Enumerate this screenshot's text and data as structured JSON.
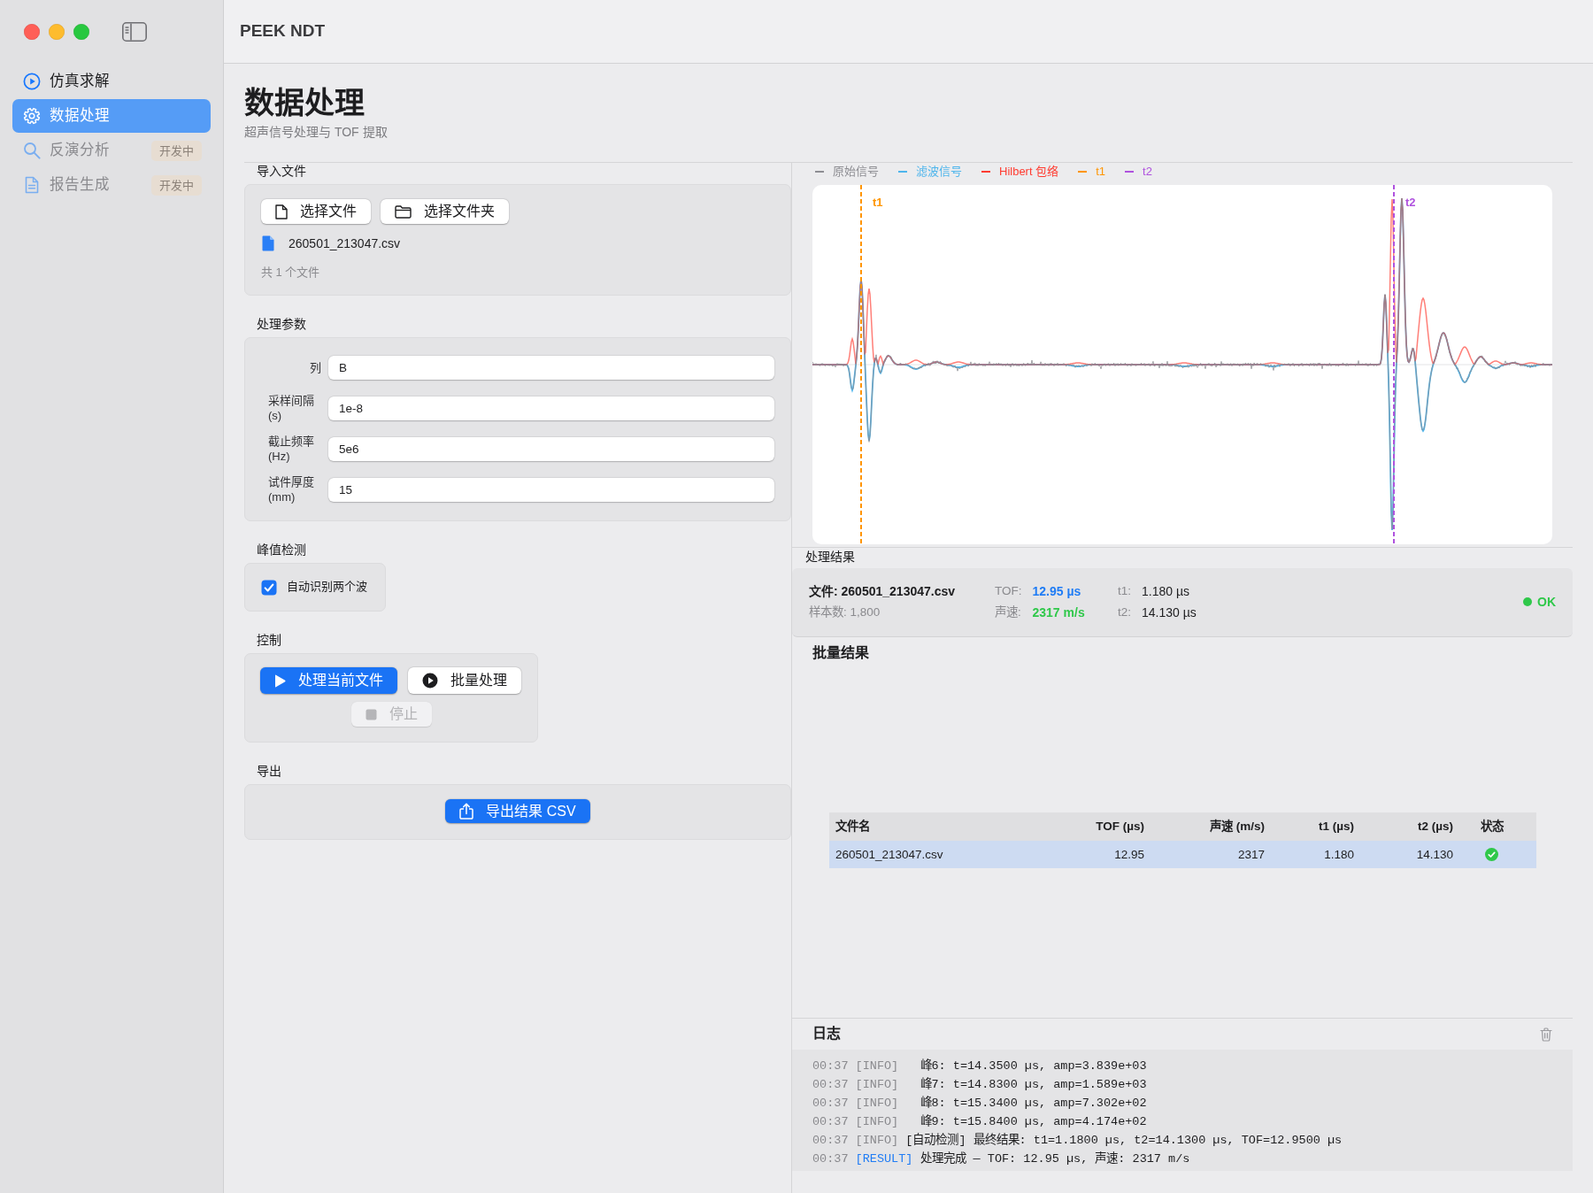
{
  "window": {
    "title": "PEEK NDT"
  },
  "sidebar": {
    "items": [
      {
        "label": "仿真求解",
        "selected": false,
        "disabled": false
      },
      {
        "label": "数据处理",
        "selected": true,
        "disabled": false
      },
      {
        "label": "反演分析",
        "selected": false,
        "disabled": true,
        "badge": "开发中"
      },
      {
        "label": "报告生成",
        "selected": false,
        "disabled": true,
        "badge": "开发中"
      }
    ]
  },
  "page": {
    "title": "数据处理",
    "subtitle": "超声信号处理与 TOF 提取"
  },
  "import_files": {
    "heading": "导入文件",
    "buttons": [
      "选择文件",
      "选择文件夹"
    ],
    "files": [
      "260501_213047.csv"
    ],
    "count": "共 1 个文件"
  },
  "parameters": {
    "heading": "处理参数",
    "fields": [
      {
        "label": "列",
        "value": "B"
      },
      {
        "label": "采样间隔 (s)",
        "value": "1e-8"
      },
      {
        "label": "截止频率 (Hz)",
        "value": "5e6"
      },
      {
        "label": "试件厚度 (mm)",
        "value": "15"
      }
    ]
  },
  "peak_detection": {
    "heading": "峰值检测",
    "checkbox": {
      "label": "自动识别两个波",
      "checked": true
    }
  },
  "control": {
    "heading": "控制",
    "buttons": [
      {
        "label": "处理当前文件",
        "kind": "primary",
        "disabled": false
      },
      {
        "label": "批量处理",
        "kind": "default",
        "disabled": false
      },
      {
        "label": "停止",
        "kind": "default",
        "disabled": true
      }
    ]
  },
  "export": {
    "heading": "导出",
    "button": "导出结果 CSV"
  },
  "signal_plot": {
    "legend": [
      {
        "label": "原始信号",
        "color": "#8e8e93"
      },
      {
        "label": "滤波信号",
        "color": "#4eb5ec"
      },
      {
        "label": "Hilbert 包络",
        "color": "#ff3b30"
      },
      {
        "label": "t1",
        "color": "#ff9500"
      },
      {
        "label": "t2",
        "color": "#af52de"
      }
    ],
    "markers": [
      {
        "label": "t1",
        "color": "#ff9500"
      },
      {
        "label": "t2",
        "color": "#af52de"
      }
    ]
  },
  "results": {
    "heading": "处理结果",
    "file": "文件: 260501_213047.csv",
    "samples": "样本数: 1,800",
    "metric_columns": [
      [
        {
          "label": "TOF:",
          "value": "12.95 µs",
          "color": "#1f7cf5"
        },
        {
          "label": "声速:",
          "value": "2317 m/s",
          "color": "#2fc84a"
        }
      ],
      [
        {
          "label": "t1:",
          "value": "1.180 µs"
        },
        {
          "label": "t2:",
          "value": "14.130 µs"
        }
      ]
    ],
    "status": {
      "label": "OK",
      "color": "#2fc84a"
    }
  },
  "batch": {
    "heading": "批量结果",
    "columns": [
      "文件名",
      "TOF (µs)",
      "声速 (m/s)",
      "t1 (µs)",
      "t2 (µs)",
      "状态"
    ],
    "rows": [
      {
        "cells": [
          "260501_213047.csv",
          "12.95",
          "2317",
          "1.180",
          "14.130"
        ],
        "ok": true,
        "selected": true
      }
    ]
  },
  "log": {
    "heading": "日志",
    "lines": [
      {
        "time": "00:37",
        "tag": "[INFO]",
        "kind": "peak",
        "message": "峰6: t=14.3500 µs, amp=3.839e+03"
      },
      {
        "time": "00:37",
        "tag": "[INFO]",
        "kind": "peak",
        "message": "峰7: t=14.8300 µs, amp=1.589e+03"
      },
      {
        "time": "00:37",
        "tag": "[INFO]",
        "kind": "peak",
        "message": "峰8: t=15.3400 µs, amp=7.302e+02"
      },
      {
        "time": "00:37",
        "tag": "[INFO]",
        "kind": "peak",
        "message": "峰9: t=15.8400 µs, amp=4.174e+02"
      },
      {
        "time": "00:37",
        "tag": "[INFO]",
        "kind": "info",
        "message": "[自动检测] 最终结果: t1=1.1800 µs, t2=14.1300 µs, TOF=12.9500 µs"
      },
      {
        "time": "00:37",
        "tag": "[RESULT]",
        "kind": "result",
        "message": "处理完成 — TOF: 12.95 µs, 声速: 2317 m/s"
      }
    ]
  }
}
